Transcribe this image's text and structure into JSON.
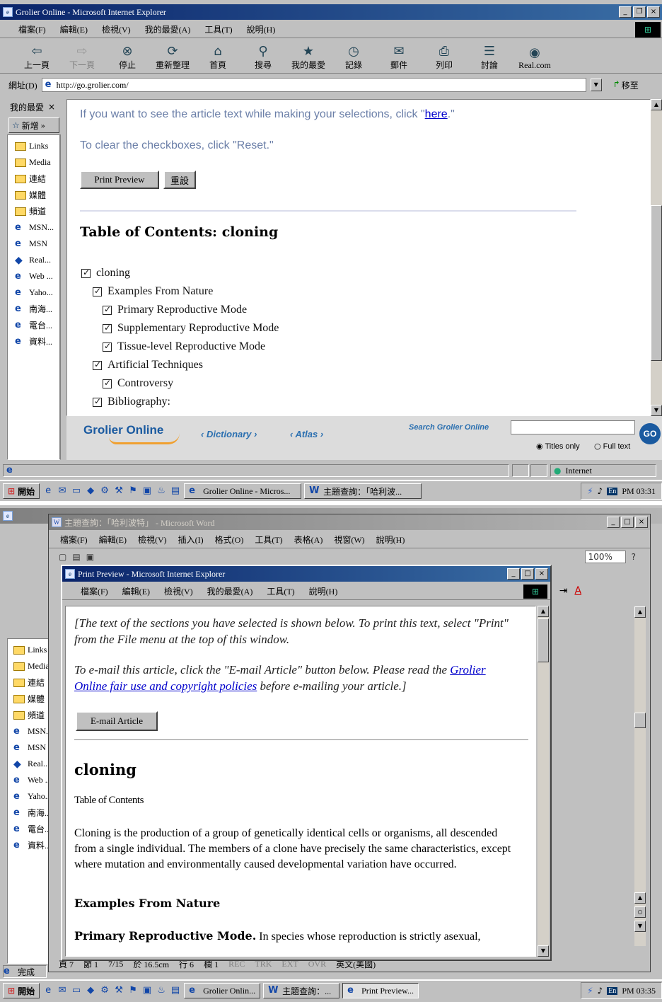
{
  "top": {
    "window_title": "Grolier Online - Microsoft Internet Explorer",
    "menu": [
      "檔案(F)",
      "編輯(E)",
      "檢視(V)",
      "我的最愛(A)",
      "工具(T)",
      "說明(H)"
    ],
    "toolbar": [
      {
        "label": "上一頁",
        "icon": "back-arrow-icon",
        "glyph": "⇦",
        "disabled": false
      },
      {
        "label": "下一頁",
        "icon": "forward-arrow-icon",
        "glyph": "⇨",
        "disabled": true
      },
      {
        "label": "停止",
        "icon": "stop-icon",
        "glyph": "⊗",
        "disabled": false
      },
      {
        "label": "重新整理",
        "icon": "refresh-icon",
        "glyph": "⟳",
        "disabled": false
      },
      {
        "label": "首頁",
        "icon": "home-icon",
        "glyph": "⌂",
        "disabled": false
      },
      {
        "label": "搜尋",
        "icon": "search-icon",
        "glyph": "⚲",
        "disabled": false
      },
      {
        "label": "我的最愛",
        "icon": "favorites-icon",
        "glyph": "★",
        "disabled": false
      },
      {
        "label": "記錄",
        "icon": "history-icon",
        "glyph": "◷",
        "disabled": false
      },
      {
        "label": "郵件",
        "icon": "mail-icon",
        "glyph": "✉",
        "disabled": false
      },
      {
        "label": "列印",
        "icon": "print-icon",
        "glyph": "⎙",
        "disabled": false
      },
      {
        "label": "討論",
        "icon": "discuss-icon",
        "glyph": "☰",
        "disabled": false
      },
      {
        "label": "Real.com",
        "icon": "real-com-icon",
        "glyph": "◉",
        "disabled": false
      }
    ],
    "address_label": "網址(D)",
    "address_value": "http://go.grolier.com/",
    "go_label": "移至",
    "sidebar_title": "我的最愛",
    "sidebar_close": "×",
    "sidebar_add": "新增",
    "sidebar_items": [
      {
        "label": "Links",
        "type": "folder"
      },
      {
        "label": "Media",
        "type": "folder"
      },
      {
        "label": "連結",
        "type": "folder"
      },
      {
        "label": "媒體",
        "type": "folder"
      },
      {
        "label": "頻道",
        "type": "folder"
      },
      {
        "label": "MSN...",
        "type": "ie"
      },
      {
        "label": "MSN",
        "type": "ie"
      },
      {
        "label": "Real...",
        "type": "real"
      },
      {
        "label": "Web ...",
        "type": "ie"
      },
      {
        "label": "Yaho...",
        "type": "ie"
      },
      {
        "label": "南海...",
        "type": "ie"
      },
      {
        "label": "電台...",
        "type": "ie"
      },
      {
        "label": "資料...",
        "type": "ie"
      }
    ],
    "page": {
      "line1_pre": "If you want to see the article text while making your selections, click \"",
      "line1_link": "here",
      "line1_post": ".\"",
      "line2": "To clear the checkboxes, click \"Reset.\"",
      "btn_print_preview": "Print Preview",
      "btn_reset": "重設",
      "toc_title": "Table of Contents: cloning",
      "toc": [
        {
          "label": "cloning",
          "level": 0,
          "checked": true
        },
        {
          "label": "Examples From Nature",
          "level": 1,
          "checked": true
        },
        {
          "label": "Primary Reproductive Mode",
          "level": 2,
          "checked": true
        },
        {
          "label": "Supplementary Reproductive Mode",
          "level": 2,
          "checked": true
        },
        {
          "label": "Tissue-level Reproductive Mode",
          "level": 2,
          "checked": true
        },
        {
          "label": "Artificial Techniques",
          "level": 1,
          "checked": true
        },
        {
          "label": "Controversy",
          "level": 2,
          "checked": true
        },
        {
          "label": "Bibliography:",
          "level": 1,
          "checked": true
        }
      ],
      "footer": {
        "logo": "Grolier Online",
        "dictionary": "Dictionary",
        "atlas": "Atlas",
        "search_label": "Search Grolier Online",
        "go": "GO",
        "titles_only": "Titles only",
        "full_text": "Full text"
      }
    },
    "status_zone": "Internet",
    "taskbar": {
      "start": "開始",
      "tasks": [
        "Grolier Online - Micros...",
        "主題查詢：「哈利波..."
      ],
      "clock": "PM 03:31"
    }
  },
  "bottom": {
    "word_title": "主題查詢：「哈利波特」 - Microsoft Word",
    "word_menu": [
      "檔案(F)",
      "編輯(E)",
      "檢視(V)",
      "插入(I)",
      "格式(O)",
      "工具(T)",
      "表格(A)",
      "視窗(W)",
      "說明(H)"
    ],
    "word_zoom": "100%",
    "word_status": [
      "頁 7",
      "節 1",
      "7/15",
      "於 16.5cm",
      "行 6",
      "欄 1",
      "REC",
      "TRK",
      "EXT",
      "OVR",
      "英文(美國)"
    ],
    "pp_title": "Print Preview - Microsoft Internet Explorer",
    "pp_menu": [
      "檔案(F)",
      "編輯(E)",
      "檢視(V)",
      "我的最愛(A)",
      "工具(T)",
      "說明(H)"
    ],
    "pp": {
      "intro": "[The text of the sections you have selected is shown below. To print this text, select \"Print\" from the File menu at the top of this window.",
      "email_pre": "To e-mail this article, click the \"E-mail Article\" button below. Please read the ",
      "email_link": "Grolier Online fair use and copyright policies",
      "email_post": " before e-mailing your article.]",
      "email_btn": "E-mail Article",
      "heading": "cloning",
      "toc_label": "Table of Contents",
      "para": "Cloning is the production of a group of genetically identical cells or organisms, all descended from a single individual. The members of a clone have precisely the same characteristics, except where mutation and environmentally caused developmental variation have occurred.",
      "sub1": "Examples From Nature",
      "sub2": "Primary Reproductive Mode.",
      "sub2_text": " In species whose reproduction is strictly asexual,"
    },
    "bg_status": "完成",
    "taskbar": {
      "start": "開始",
      "tasks": [
        "Grolier Onlin...",
        "主題查詢：...",
        "Print Preview..."
      ],
      "clock": "PM 03:35"
    }
  }
}
